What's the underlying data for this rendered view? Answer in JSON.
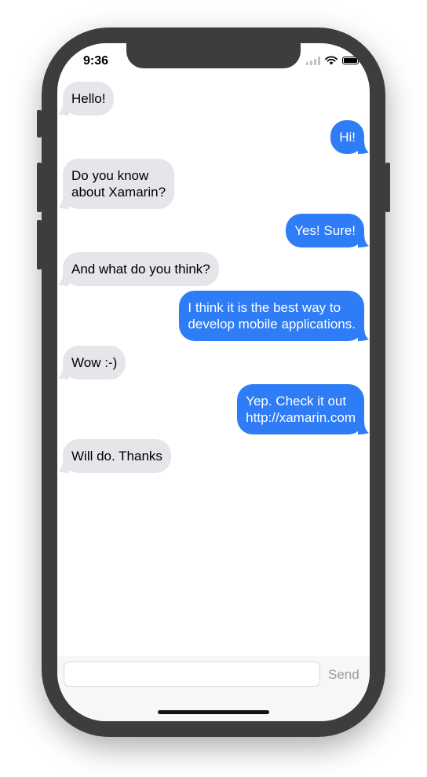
{
  "status_bar": {
    "time": "9:36"
  },
  "messages": [
    {
      "direction": "incoming",
      "text": "Hello!"
    },
    {
      "direction": "outgoing",
      "text": "Hi!"
    },
    {
      "direction": "incoming",
      "text": "Do you know\nabout Xamarin?"
    },
    {
      "direction": "outgoing",
      "text": "Yes! Sure!"
    },
    {
      "direction": "incoming",
      "text": "And what do you think?"
    },
    {
      "direction": "outgoing",
      "text": "I think it is the best way to\ndevelop mobile applications."
    },
    {
      "direction": "incoming",
      "text": "Wow :-)"
    },
    {
      "direction": "outgoing",
      "text": "Yep. Check it out\nhttp://xamarin.com"
    },
    {
      "direction": "incoming",
      "text": "Will do. Thanks"
    }
  ],
  "composer": {
    "value": "",
    "send_label": "Send"
  },
  "colors": {
    "incoming_bubble": "#e5e5ea",
    "outgoing_bubble": "#2e7cf6",
    "send_disabled": "#9b9b9b"
  }
}
